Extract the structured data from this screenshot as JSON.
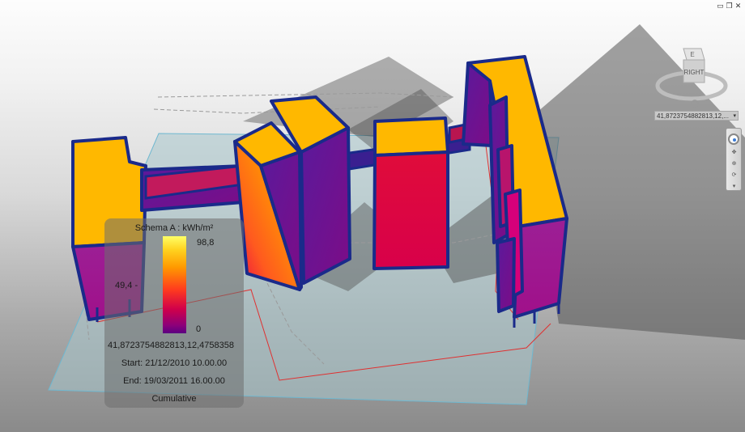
{
  "window": {
    "controls": [
      "▭",
      "❐",
      "✕"
    ]
  },
  "viewcube": {
    "face_label": "RIGHT",
    "compass_label": "E"
  },
  "coord_display": {
    "value": "41,8723754882813,12,...",
    "dropdown_icon": "chevron-down-icon"
  },
  "legend": {
    "title": "Schema A : kWh/m²",
    "max_label": "98,8",
    "mid_label": "49,4 -",
    "min_label": "0",
    "coordinates": "41,8723754882813,12,4758358",
    "start": "Start: 21/12/2010 10.00.00",
    "end": "End: 19/03/2011 16.00.00",
    "mode": "Cumulative",
    "scale_colors": [
      "#ffff66",
      "#ffd21f",
      "#ff9900",
      "#ff3b1e",
      "#d0004a",
      "#8b007a",
      "#5b0081"
    ]
  },
  "colors": {
    "building_top": "#ffb800",
    "building_outline": "#1a2a8a",
    "ground_plane": "#a8c6cc",
    "shadow": "#6e6e6e"
  }
}
